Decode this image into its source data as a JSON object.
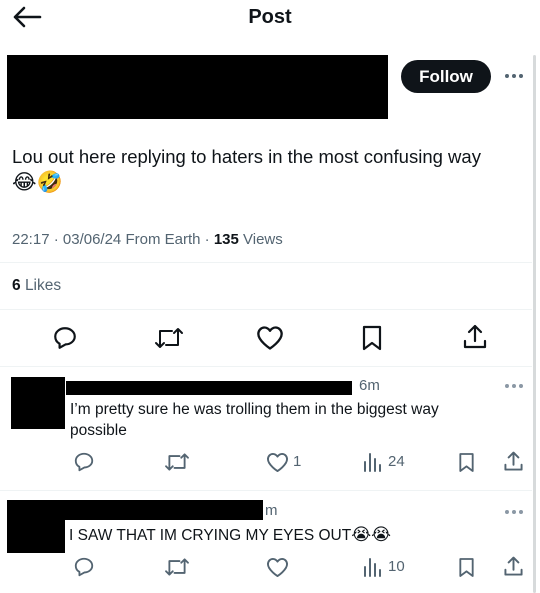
{
  "header": {
    "title": "Post",
    "back_icon": "arrow-left-icon"
  },
  "post": {
    "follow_label": "Follow",
    "text": "Lou out here replying to haters in the most confusing way",
    "emojis": "😂🤣",
    "time": "22:17",
    "date": "03/06/24",
    "source": "From Earth",
    "views_count": "135",
    "views_label": "Views",
    "likes_count": "6",
    "likes_label": "Likes",
    "actions": [
      "reply-icon",
      "repost-icon",
      "like-icon",
      "bookmark-icon",
      "share-icon"
    ]
  },
  "replies": [
    {
      "time_fragment": "6m",
      "text_line1": "I’m pretty sure he was trolling them in the biggest way",
      "text_line2": "possible",
      "likes": "1",
      "views": "24"
    },
    {
      "time_fragment": "m",
      "text": "I SAW THAT IM CRYING MY EYES OUT",
      "emojis": "😭😭",
      "likes": "",
      "views": "10"
    }
  ],
  "colors": {
    "text": "#0f1419",
    "muted": "#536471",
    "divider": "#eff3f4",
    "button": "#0f1419"
  }
}
